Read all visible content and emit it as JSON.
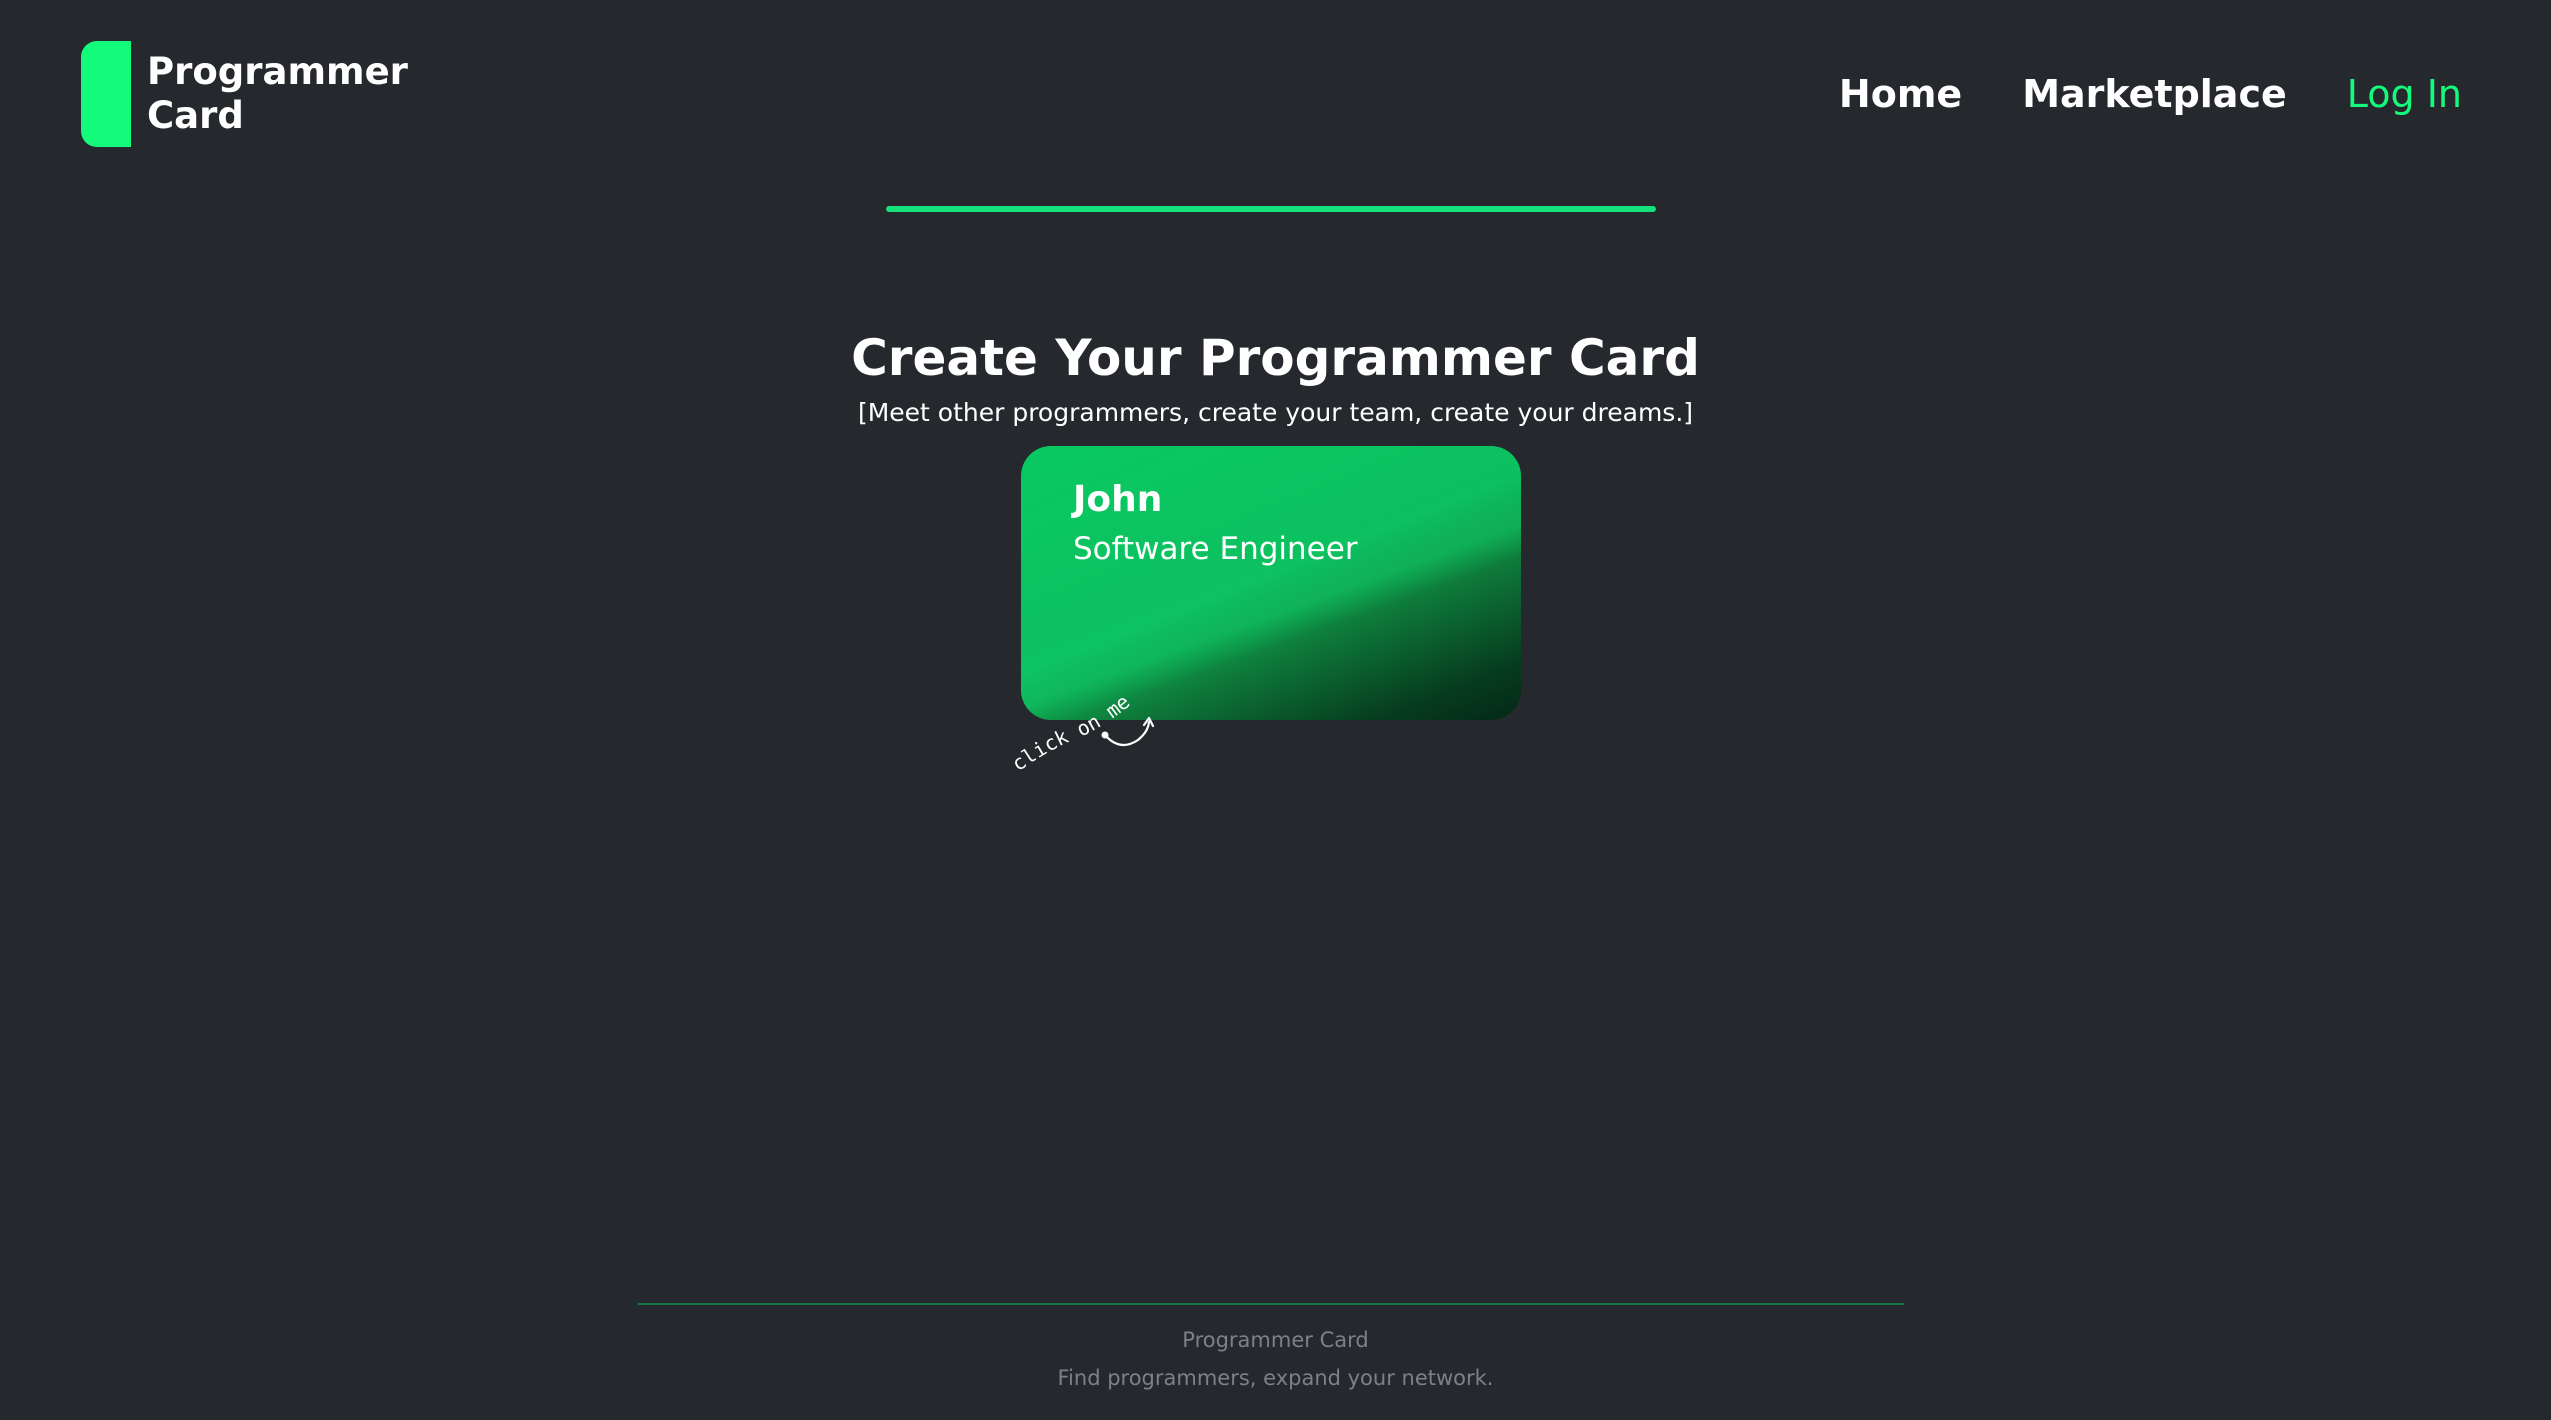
{
  "header": {
    "logo_text": "Programmer Card",
    "nav": {
      "home": "Home",
      "marketplace": "Marketplace",
      "login": "Log In"
    }
  },
  "hero": {
    "title": "Create Your Programmer Card",
    "subtitle": "[Meet other programmers, create your team, create your dreams.]"
  },
  "card": {
    "name": "John",
    "role": "Software Engineer",
    "hint": "click on me"
  },
  "footer": {
    "title": "Programmer Card",
    "tagline": "Find programmers, expand your network."
  },
  "colors": {
    "background": "#25282c",
    "accent": "#14fb7c",
    "card_green": "#0ac961",
    "footer_text": "#7d8186"
  }
}
